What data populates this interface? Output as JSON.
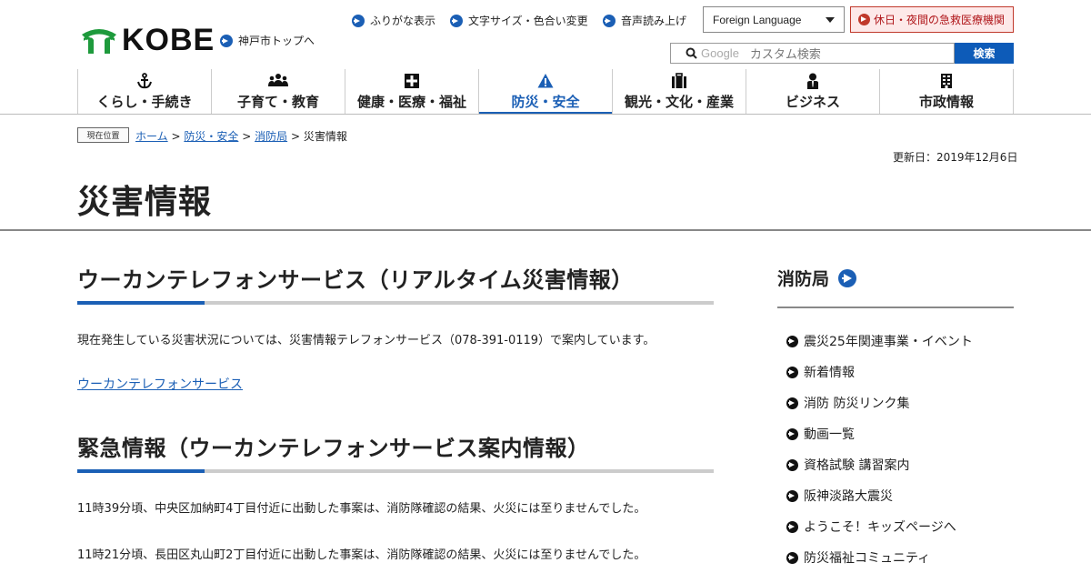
{
  "header": {
    "logo_text": "KOBE",
    "top_link": "神戸市トップへ",
    "util_links": [
      "ふりがな表示",
      "文字サイズ・色合い変更",
      "音声読み上げ"
    ],
    "language_select": "Foreign Language",
    "emergency_link": "休日・夜間の急救医療機関",
    "search_brand": "Google",
    "search_placeholder": "カスタム検索",
    "search_button": "検索"
  },
  "nav": [
    {
      "label": "くらし・手続き",
      "icon": "anchor-icon"
    },
    {
      "label": "子育て・教育",
      "icon": "people-icon"
    },
    {
      "label": "健康・医療・福祉",
      "icon": "hospital-icon"
    },
    {
      "label": "防災・安全",
      "icon": "warning-icon",
      "active": true
    },
    {
      "label": "観光・文化・産業",
      "icon": "suitcase-icon"
    },
    {
      "label": "ビジネス",
      "icon": "person-icon"
    },
    {
      "label": "市政情報",
      "icon": "building-icon"
    }
  ],
  "breadcrumb": {
    "here_label": "現在位置",
    "home": "ホーム",
    "sep": ">",
    "level1": "防災・安全",
    "level2": "消防局",
    "current": "災害情報"
  },
  "updated": "更新日：2019年12月6日",
  "page_title": "災害情報",
  "sections": [
    {
      "heading": "ウーカンテレフォンサービス（リアルタイム災害情報）",
      "text": "現在発生している災害状況については、災害情報テレフォンサービス（078-391-0119）で案内しています。",
      "link": "ウーカンテレフォンサービス"
    },
    {
      "heading": "緊急情報（ウーカンテレフォンサービス案内情報）",
      "items": [
        "11時39分頃、中央区加納町4丁目付近に出動した事案は、消防隊確認の結果、火災には至りませんでした。",
        "11時21分頃、長田区丸山町2丁目付近に出動した事案は、消防隊確認の結果、火災には至りませんでした。"
      ]
    }
  ],
  "sidebar": {
    "title": "消防局",
    "items": [
      "震災25年関連事業・イベント",
      "新着情報",
      "消防 防災リンク集",
      "動画一覧",
      "資格試験 講習案内",
      "阪神淡路大震災",
      "ようこそ！キッズページへ",
      "防災福祉コミュニティ"
    ]
  },
  "colors": {
    "accent": "#1b5fb5",
    "emergency": "#c0392b",
    "logo_green": "#1e9a3c"
  }
}
